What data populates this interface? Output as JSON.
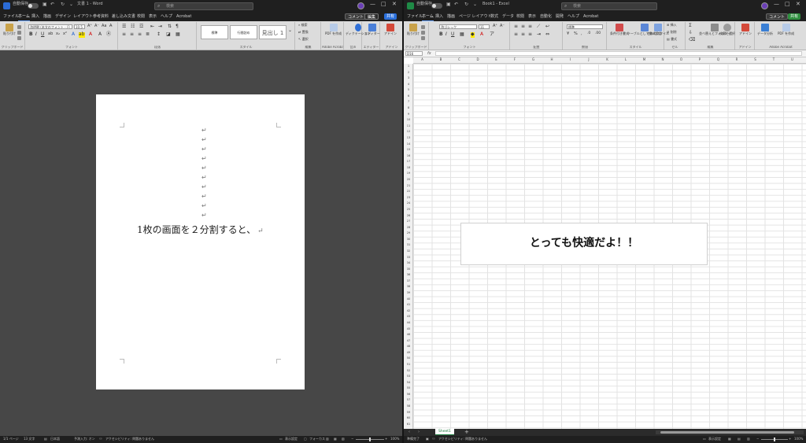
{
  "word": {
    "autosave": "自動保存",
    "doc_title": "文書 1 - Word",
    "search_placeholder": "検索",
    "tabs": [
      "ファイル",
      "ホーム",
      "挿入",
      "描画",
      "デザイン",
      "レイアウト",
      "参考資料",
      "差し込み文書",
      "校閲",
      "表示",
      "ヘルプ",
      "Acrobat"
    ],
    "comment_label": "コメント",
    "edit_label": "編集",
    "share_label": "共有",
    "ribbon": {
      "paste": "貼り付け",
      "font_name": "游明朝 (本文のフォント - 日",
      "font_size": "10.5",
      "styles": [
        "標準",
        "行間詰め",
        "見出し 1"
      ],
      "find": "検索",
      "replace": "置換",
      "select": "選択",
      "dictation": "ディクテーション",
      "editor": "エディター",
      "addins": "アドイン",
      "pdf": "PDF を作成",
      "groups": [
        "クリップボード",
        "フォント",
        "段落",
        "スタイル",
        "編集",
        "Adobe Acrobat",
        "音声",
        "エディター",
        "アドイン"
      ]
    },
    "document_text": "1枚の画面を２分割すると、",
    "status": {
      "page": "1/1 ページ",
      "words": "13 文字",
      "lang": "日本語",
      "input": "予測入力: オン",
      "access": "アクセシビリティ: 問題ありません",
      "display": "表示設定",
      "focus": "フォーカス",
      "zoom": "100%"
    }
  },
  "excel": {
    "autosave": "自動保存",
    "doc_title": "Book1 - Excel",
    "search_placeholder": "検索",
    "tabs": [
      "ファイル",
      "ホーム",
      "挿入",
      "描画",
      "ページ レイアウト",
      "数式",
      "データ",
      "校閲",
      "表示",
      "自動化",
      "開発",
      "ヘルプ",
      "Acrobat"
    ],
    "comment_label": "コメント",
    "share_label": "共有",
    "ribbon": {
      "paste": "貼り付け",
      "font_name": "游ゴシック",
      "font_size": "11",
      "number_format": "標準",
      "cond_format": "条件付き書式",
      "table_format": "テーブルとして書式設定",
      "cell_styles": "セルのスタイル",
      "insert": "挿入",
      "delete": "削除",
      "format": "書式",
      "sort": "並べ替えとフィルター",
      "find": "検索と選択",
      "addins": "アドイン",
      "analyze": "データ分析",
      "pdf": "PDF を作成",
      "groups": [
        "クリップボード",
        "フォント",
        "配置",
        "数値",
        "スタイル",
        "セル",
        "編集",
        "アドイン",
        "Adobe Acrobat"
      ]
    },
    "name_box": "D16",
    "fx": "fx",
    "columns": [
      "A",
      "B",
      "C",
      "D",
      "E",
      "F",
      "G",
      "H",
      "I",
      "J",
      "K",
      "L",
      "M",
      "N",
      "O",
      "P",
      "Q",
      "R",
      "S",
      "T",
      "U"
    ],
    "rows": [
      "1",
      "2",
      "3",
      "4",
      "5",
      "6",
      "7",
      "8",
      "9",
      "10",
      "11",
      "12",
      "13",
      "14",
      "15",
      "16",
      "17",
      "18",
      "19",
      "20",
      "21",
      "22",
      "23",
      "24",
      "25",
      "26",
      "27",
      "28",
      "29",
      "30",
      "31",
      "32",
      "33",
      "34",
      "35",
      "36",
      "37",
      "38",
      "39",
      "40",
      "41",
      "42",
      "43",
      "44",
      "45",
      "46",
      "47",
      "48",
      "49",
      "50",
      "51",
      "52",
      "53",
      "54",
      "55",
      "56",
      "57",
      "58",
      "59",
      "60",
      "61"
    ],
    "textbox_text": "とっても快適だよ！！",
    "sheet_tab": "Sheet1",
    "status": {
      "ready": "準備完了",
      "access": "アクセシビリティ: 問題ありません",
      "display": "表示設定",
      "zoom": "100%"
    }
  }
}
